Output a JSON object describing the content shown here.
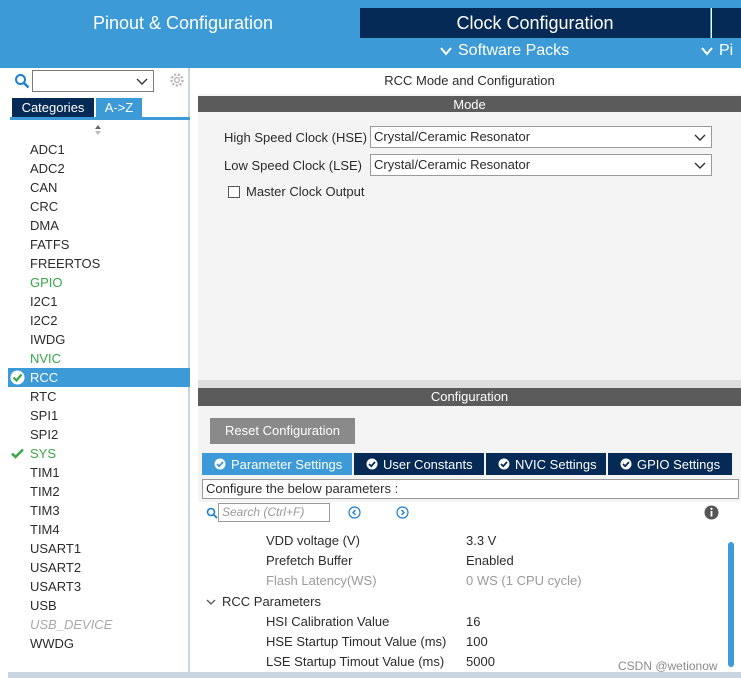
{
  "top_tabs": {
    "pinout": "Pinout & Configuration",
    "clock": "Clock Configuration"
  },
  "subnav": {
    "software_packs": "Software Packs",
    "pinout_truncated": "Pi"
  },
  "left": {
    "search_value": "",
    "tabs": [
      "Categories",
      "A->Z"
    ],
    "active_tab": "A->Z",
    "peripherals": [
      {
        "label": "ADC1",
        "state": "normal"
      },
      {
        "label": "ADC2",
        "state": "normal"
      },
      {
        "label": "CAN",
        "state": "normal"
      },
      {
        "label": "CRC",
        "state": "normal"
      },
      {
        "label": "DMA",
        "state": "normal"
      },
      {
        "label": "FATFS",
        "state": "normal"
      },
      {
        "label": "FREERTOS",
        "state": "normal"
      },
      {
        "label": "GPIO",
        "state": "green"
      },
      {
        "label": "I2C1",
        "state": "normal"
      },
      {
        "label": "I2C2",
        "state": "normal"
      },
      {
        "label": "IWDG",
        "state": "normal"
      },
      {
        "label": "NVIC",
        "state": "green"
      },
      {
        "label": "RCC",
        "state": "selected"
      },
      {
        "label": "RTC",
        "state": "normal"
      },
      {
        "label": "SPI1",
        "state": "normal"
      },
      {
        "label": "SPI2",
        "state": "normal"
      },
      {
        "label": "SYS",
        "state": "green-check"
      },
      {
        "label": "TIM1",
        "state": "normal"
      },
      {
        "label": "TIM2",
        "state": "normal"
      },
      {
        "label": "TIM3",
        "state": "normal"
      },
      {
        "label": "TIM4",
        "state": "normal"
      },
      {
        "label": "USART1",
        "state": "normal"
      },
      {
        "label": "USART2",
        "state": "normal"
      },
      {
        "label": "USART3",
        "state": "normal"
      },
      {
        "label": "USB",
        "state": "normal"
      },
      {
        "label": "USB_DEVICE",
        "state": "disabled"
      },
      {
        "label": "WWDG",
        "state": "normal"
      }
    ]
  },
  "right": {
    "title": "RCC Mode and Configuration",
    "mode_bar": "Mode",
    "hse": {
      "label": "High Speed Clock (HSE)",
      "value": "Crystal/Ceramic Resonator"
    },
    "lse": {
      "label": "Low Speed Clock (LSE)",
      "value": "Crystal/Ceramic Resonator"
    },
    "mco": {
      "label": "Master Clock Output",
      "checked": false
    },
    "config_bar": "Configuration",
    "reset_button": "Reset Configuration",
    "config_tabs": [
      "Parameter Settings",
      "User Constants",
      "NVIC Settings",
      "GPIO Settings"
    ],
    "active_config_tab": "Parameter Settings",
    "config_desc": "Configure the below parameters :",
    "param_search_placeholder": "Search (Ctrl+F)",
    "params": [
      {
        "name": "VDD voltage (V)",
        "value": "3.3 V",
        "disabled": false
      },
      {
        "name": "Prefetch Buffer",
        "value": "Enabled",
        "disabled": false
      },
      {
        "name": "Flash Latency(WS)",
        "value": "0 WS (1 CPU cycle)",
        "disabled": true
      }
    ],
    "group": "RCC Parameters",
    "group_params": [
      {
        "name": "HSI Calibration Value",
        "value": "16"
      },
      {
        "name": "HSE Startup Timout Value (ms)",
        "value": "100"
      },
      {
        "name": "LSE Startup Timout Value (ms)",
        "value": "5000"
      }
    ],
    "watermark": "CSDN @wetionow"
  },
  "colors": {
    "accent_blue": "#3c9ad6",
    "navy": "#052a55",
    "status_green": "#3aa64a",
    "bar_gray": "#5b5b5b"
  }
}
